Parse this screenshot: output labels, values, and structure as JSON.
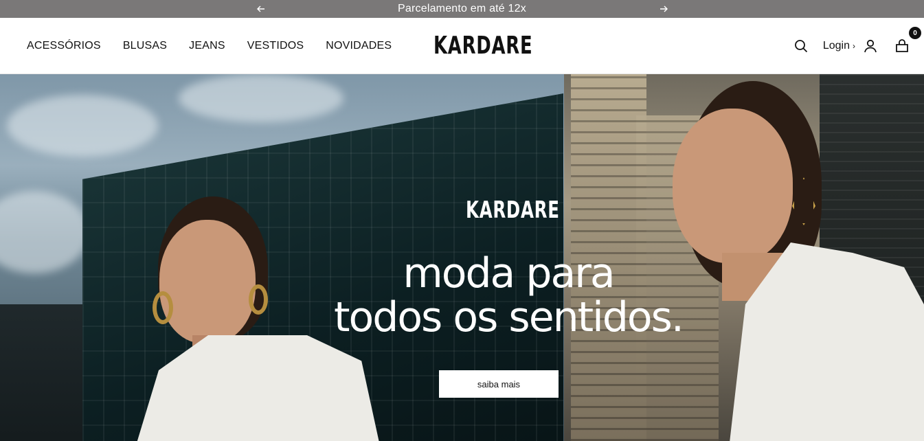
{
  "announcement": {
    "text": "Parcelamento em até 12x"
  },
  "header": {
    "nav": [
      "ACESSÓRIOS",
      "BLUSAS",
      "JEANS",
      "VESTIDOS",
      "NOVIDADES"
    ],
    "logo": "KARDARE",
    "login_label": "Login",
    "login_chevron": "›",
    "cart_count": "0"
  },
  "hero": {
    "brand": "KARDARE",
    "headline_line1": "moda para",
    "headline_line2": "todos os sentidos.",
    "cta_label": "saiba mais"
  },
  "colors": {
    "announce_bg": "#7a7878",
    "text": "#111111",
    "cta_bg": "#ffffff"
  },
  "icons": [
    "arrow-left-icon",
    "arrow-right-icon",
    "search-icon",
    "user-icon",
    "shopping-bag-icon"
  ]
}
